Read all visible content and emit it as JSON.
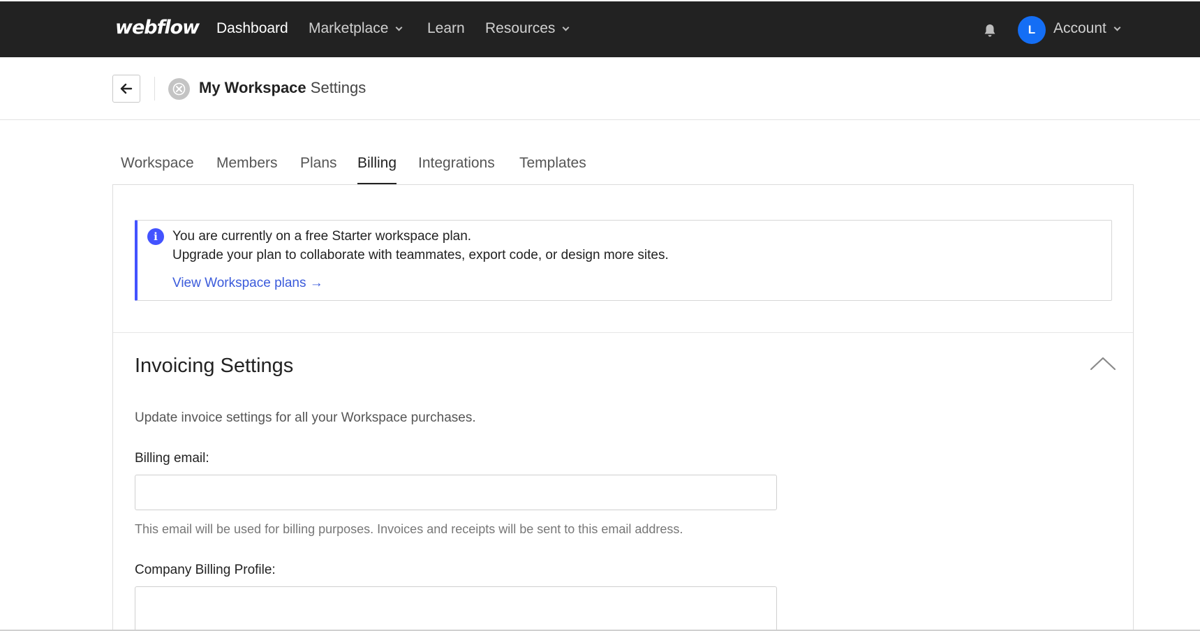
{
  "nav": {
    "logo": "webflow",
    "links": [
      "Dashboard",
      "Marketplace",
      "Learn",
      "Resources"
    ],
    "account_initial": "L",
    "account_label": "Account"
  },
  "header": {
    "workspace_name": "My Workspace",
    "title_suffix": "Settings"
  },
  "tabs": [
    "Workspace",
    "Members",
    "Plans",
    "Billing",
    "Integrations",
    "Templates"
  ],
  "active_tab": "Billing",
  "notice": {
    "line1": "You are currently on a free Starter workspace plan.",
    "line2": "Upgrade your plan to collaborate with teammates, export code, or design more sites.",
    "link": "View Workspace plans →"
  },
  "invoicing": {
    "title": "Invoicing Settings",
    "description": "Update invoice settings for all your Workspace purchases.",
    "billing_email_label": "Billing email:",
    "billing_email_value": "",
    "billing_email_help": "This email will be used for billing purposes. Invoices and receipts will be sent to this email address.",
    "company_profile_label": "Company Billing Profile:",
    "company_profile_value": ""
  },
  "colors": {
    "nav_bg": "#222222",
    "accent": "#4353ff",
    "avatar": "#146ef5",
    "link": "#3b5bdb"
  }
}
